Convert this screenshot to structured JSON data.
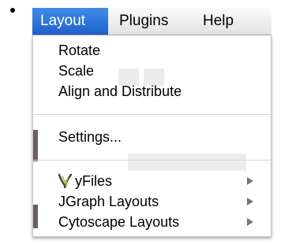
{
  "menubar": {
    "items": [
      {
        "label": "Layout",
        "active": true
      },
      {
        "label": "Plugins",
        "active": false
      },
      {
        "label": "Help",
        "active": false
      }
    ]
  },
  "menu": {
    "group1": [
      {
        "label": "Rotate"
      },
      {
        "label": "Scale"
      },
      {
        "label": "Align and Distribute"
      }
    ],
    "group2": [
      {
        "label": "Settings..."
      }
    ],
    "group3": [
      {
        "label": "yFiles",
        "icon": "yfiles-icon",
        "submenu": true
      },
      {
        "label": "JGraph Layouts",
        "submenu": true
      },
      {
        "label": "Cytoscape Layouts",
        "submenu": true
      }
    ]
  },
  "colors": {
    "highlight": "#2a6fd6",
    "arrow": "#777777"
  }
}
